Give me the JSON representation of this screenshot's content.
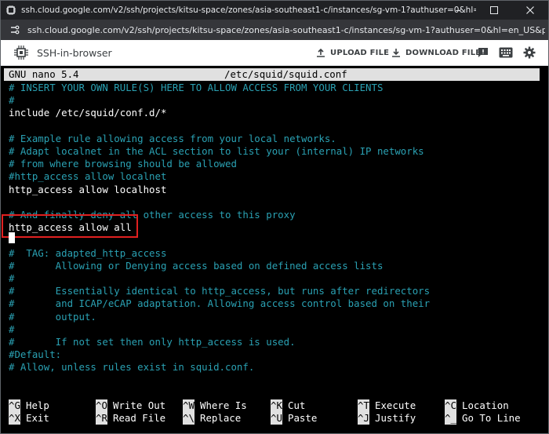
{
  "window": {
    "title": "ssh.cloud.google.com/v2/ssh/projects/kitsu-space/zones/asia-southeast1-c/instances/sg-vm-1?authuser=0&hl=en_US&projectNumber=..."
  },
  "urlbar": {
    "url": "ssh.cloud.google.com/v2/ssh/projects/kitsu-space/zones/asia-southeast1-c/instances/sg-vm-1?authuser=0&hl=en_US&projectNumbe..."
  },
  "toolbar": {
    "app_title": "SSH-in-browser",
    "upload_label": "UPLOAD FILE",
    "download_label": "DOWNLOAD FILE"
  },
  "editor": {
    "header_left": "GNU nano 5.4",
    "header_file": "/etc/squid/squid.conf",
    "lines": [
      {
        "text": "# INSERT YOUR OWN RULE(S) HERE TO ALLOW ACCESS FROM YOUR CLIENTS",
        "kind": "comment"
      },
      {
        "text": "#",
        "kind": "comment"
      },
      {
        "text": "include /etc/squid/conf.d/*",
        "kind": "code"
      },
      {
        "text": "",
        "kind": "code"
      },
      {
        "text": "# Example rule allowing access from your local networks.",
        "kind": "comment"
      },
      {
        "text": "# Adapt localnet in the ACL section to list your (internal) IP networks",
        "kind": "comment"
      },
      {
        "text": "# from where browsing should be allowed",
        "kind": "comment"
      },
      {
        "text": "#http_access allow localnet",
        "kind": "comment"
      },
      {
        "text": "http_access allow localhost",
        "kind": "code"
      },
      {
        "text": "",
        "kind": "code"
      },
      {
        "text": "# And finally deny all other access to this proxy",
        "kind": "comment"
      },
      {
        "text": "http_access allow all",
        "kind": "code"
      },
      {
        "text": "",
        "kind": "code"
      },
      {
        "text": "#  TAG: adapted_http_access",
        "kind": "comment"
      },
      {
        "text": "#       Allowing or Denying access based on defined access lists",
        "kind": "comment"
      },
      {
        "text": "#",
        "kind": "comment"
      },
      {
        "text": "#       Essentially identical to http_access, but runs after redirectors",
        "kind": "comment"
      },
      {
        "text": "#       and ICAP/eCAP adaptation. Allowing access control based on their",
        "kind": "comment"
      },
      {
        "text": "#       output.",
        "kind": "comment"
      },
      {
        "text": "#",
        "kind": "comment"
      },
      {
        "text": "#       If not set then only http_access is used.",
        "kind": "comment"
      },
      {
        "text": "#Default:",
        "kind": "comment"
      },
      {
        "text": "# Allow, unless rules exist in squid.conf.",
        "kind": "comment"
      }
    ]
  },
  "shortcuts": [
    [
      {
        "key": "^G",
        "label": "Help"
      },
      {
        "key": "^O",
        "label": "Write Out"
      },
      {
        "key": "^W",
        "label": "Where Is"
      },
      {
        "key": "^K",
        "label": "Cut"
      },
      {
        "key": "^T",
        "label": "Execute"
      },
      {
        "key": "^C",
        "label": "Location"
      }
    ],
    [
      {
        "key": "^X",
        "label": "Exit"
      },
      {
        "key": "^R",
        "label": "Read File"
      },
      {
        "key": "^\\",
        "label": "Replace"
      },
      {
        "key": "^U",
        "label": "Paste"
      },
      {
        "key": "^J",
        "label": "Justify"
      },
      {
        "key": "^_",
        "label": "Go To Line"
      }
    ]
  ]
}
